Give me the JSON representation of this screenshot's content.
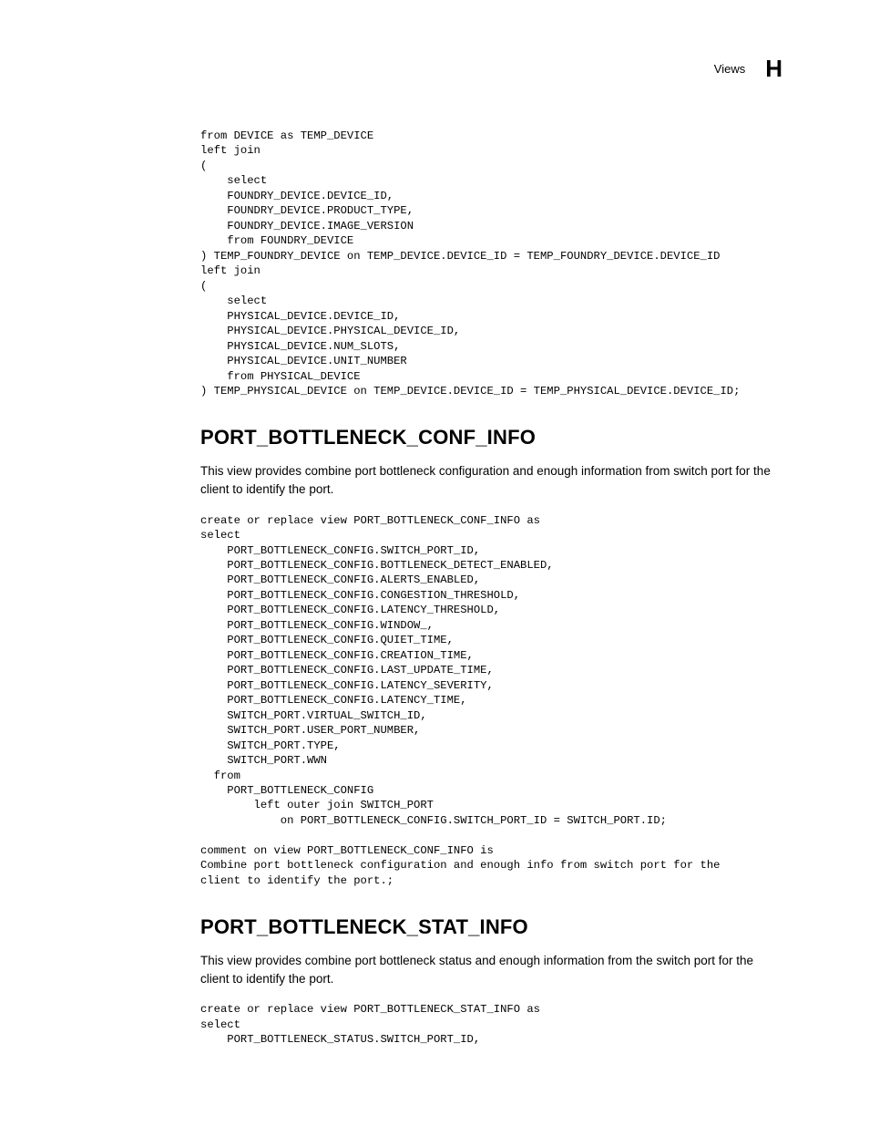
{
  "header": {
    "label": "Views",
    "letter": "H"
  },
  "code_top": "from DEVICE as TEMP_DEVICE\nleft join\n(\n    select\n    FOUNDRY_DEVICE.DEVICE_ID,\n    FOUNDRY_DEVICE.PRODUCT_TYPE,\n    FOUNDRY_DEVICE.IMAGE_VERSION\n    from FOUNDRY_DEVICE\n) TEMP_FOUNDRY_DEVICE on TEMP_DEVICE.DEVICE_ID = TEMP_FOUNDRY_DEVICE.DEVICE_ID\nleft join\n(\n    select\n    PHYSICAL_DEVICE.DEVICE_ID,\n    PHYSICAL_DEVICE.PHYSICAL_DEVICE_ID,\n    PHYSICAL_DEVICE.NUM_SLOTS,\n    PHYSICAL_DEVICE.UNIT_NUMBER\n    from PHYSICAL_DEVICE\n) TEMP_PHYSICAL_DEVICE on TEMP_DEVICE.DEVICE_ID = TEMP_PHYSICAL_DEVICE.DEVICE_ID;",
  "section1": {
    "title": "PORT_BOTTLENECK_CONF_INFO",
    "desc": "This view provides combine port bottleneck configuration and enough information from switch port for the client to identify the port.",
    "code": "create or replace view PORT_BOTTLENECK_CONF_INFO as\nselect\n    PORT_BOTTLENECK_CONFIG.SWITCH_PORT_ID,\n    PORT_BOTTLENECK_CONFIG.BOTTLENECK_DETECT_ENABLED,\n    PORT_BOTTLENECK_CONFIG.ALERTS_ENABLED,\n    PORT_BOTTLENECK_CONFIG.CONGESTION_THRESHOLD,\n    PORT_BOTTLENECK_CONFIG.LATENCY_THRESHOLD,\n    PORT_BOTTLENECK_CONFIG.WINDOW_,\n    PORT_BOTTLENECK_CONFIG.QUIET_TIME,\n    PORT_BOTTLENECK_CONFIG.CREATION_TIME,\n    PORT_BOTTLENECK_CONFIG.LAST_UPDATE_TIME,\n    PORT_BOTTLENECK_CONFIG.LATENCY_SEVERITY,\n    PORT_BOTTLENECK_CONFIG.LATENCY_TIME,\n    SWITCH_PORT.VIRTUAL_SWITCH_ID,\n    SWITCH_PORT.USER_PORT_NUMBER,\n    SWITCH_PORT.TYPE,\n    SWITCH_PORT.WWN\n  from\n    PORT_BOTTLENECK_CONFIG\n        left outer join SWITCH_PORT\n            on PORT_BOTTLENECK_CONFIG.SWITCH_PORT_ID = SWITCH_PORT.ID;\n\ncomment on view PORT_BOTTLENECK_CONF_INFO is\nCombine port bottleneck configuration and enough info from switch port for the\nclient to identify the port.;"
  },
  "section2": {
    "title": "PORT_BOTTLENECK_STAT_INFO",
    "desc": "This view provides combine port bottleneck status and enough information from the switch port for the client to identify the port.",
    "code": "create or replace view PORT_BOTTLENECK_STAT_INFO as\nselect\n    PORT_BOTTLENECK_STATUS.SWITCH_PORT_ID,"
  }
}
